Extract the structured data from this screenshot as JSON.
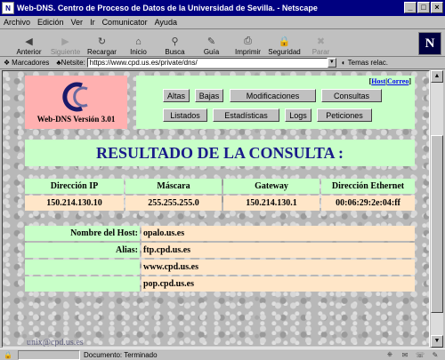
{
  "window": {
    "title": "Web-DNS. Centro de Proceso de Datos de la Universidad de Sevilla. - Netscape"
  },
  "menu": [
    "Archivo",
    "Edición",
    "Ver",
    "Ir",
    "Comunicator",
    "Ayuda"
  ],
  "toolbar": [
    {
      "label": "Anterior",
      "icon": "back-arrow-icon",
      "glyph": "◀",
      "enabled": true
    },
    {
      "label": "Siguiente",
      "icon": "forward-arrow-icon",
      "glyph": "▶",
      "enabled": false
    },
    {
      "label": "Recargar",
      "icon": "reload-icon",
      "glyph": "↻",
      "enabled": true
    },
    {
      "label": "Inicio",
      "icon": "home-icon",
      "glyph": "⌂",
      "enabled": true
    },
    {
      "label": "Busca",
      "icon": "search-icon",
      "glyph": "⚲",
      "enabled": true
    },
    {
      "label": "Guía",
      "icon": "guide-icon",
      "glyph": "✎",
      "enabled": true
    },
    {
      "label": "Imprimir",
      "icon": "print-icon",
      "glyph": "⎙",
      "enabled": true
    },
    {
      "label": "Seguridad",
      "icon": "security-icon",
      "glyph": "🔒",
      "enabled": true
    },
    {
      "label": "Parar",
      "icon": "stop-icon",
      "glyph": "✖",
      "enabled": false
    }
  ],
  "location": {
    "bookmarks_label": "Marcadores",
    "netsite_label": "Netsite:",
    "url": "https://www.cpd.us.es/private/dns/",
    "related_label": "Temas relac."
  },
  "page": {
    "logo_version": "Web-DNS Versión 3.01",
    "host_link": "Host",
    "correo_link": "Correo",
    "nav_buttons_row1": [
      "Altas",
      "Bajas",
      "Modificaciones",
      "Consultas"
    ],
    "nav_buttons_row2": [
      "Listados",
      "Estadísticas",
      "Logs",
      "Peticiones"
    ],
    "result_title": "RESULTADO DE LA CONSULTA :",
    "table": {
      "headers": [
        "Dirección IP",
        "Máscara",
        "Gateway",
        "Dirección Ethernet"
      ],
      "row": [
        "150.214.130.10",
        "255.255.255.0",
        "150.214.130.1",
        "00:06:29:2e:04:ff"
      ]
    },
    "host_label": "Nombre del Host:",
    "host_value": "opalo.us.es",
    "alias_label": "Alias:",
    "aliases": [
      "ftp.cpd.us.es",
      "www.cpd.us.es",
      "pop.cpd.us.es"
    ],
    "footer_email": "unix@cpd.us.es"
  },
  "status": {
    "text": "Documento: Terminado"
  },
  "colors": {
    "titlebar": "#000080",
    "green_panel": "#c8ffc8",
    "peach_cell": "#ffe6c8",
    "logo_bg": "#ffb0b0",
    "title_text": "#1a1a8a"
  }
}
